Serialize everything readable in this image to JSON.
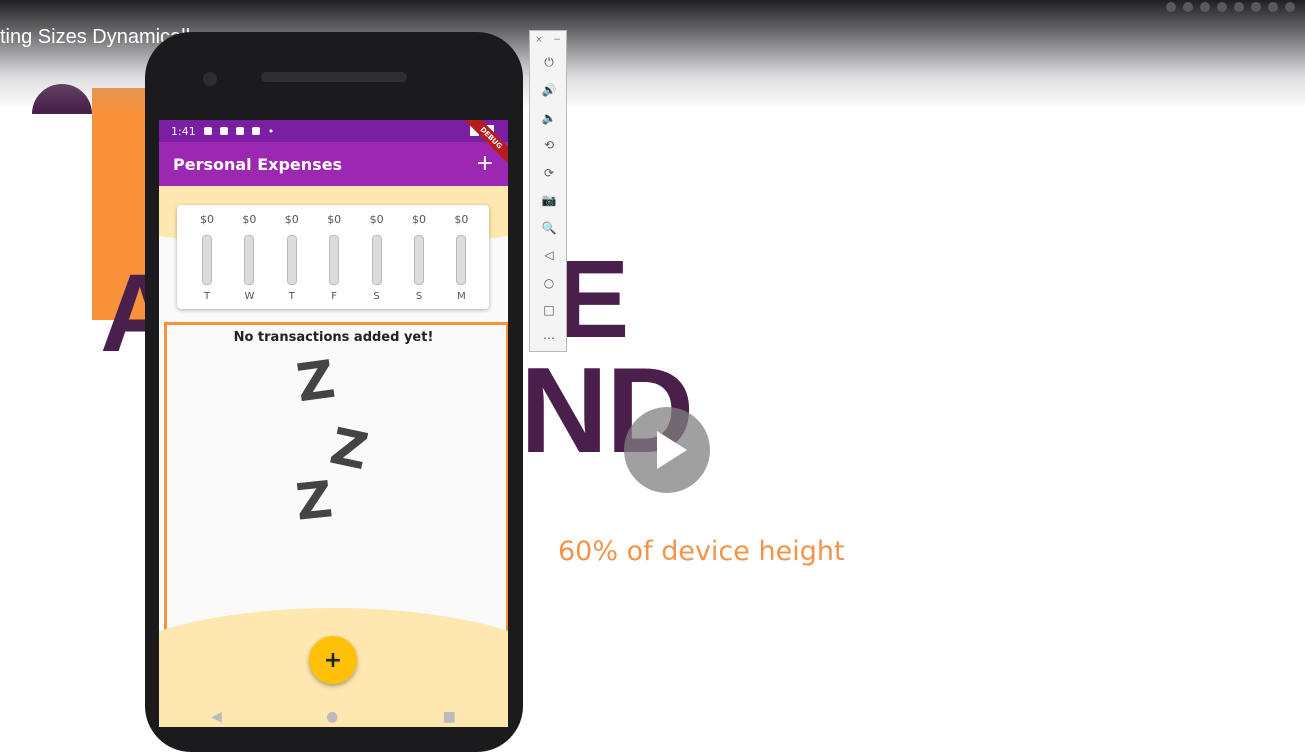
{
  "video": {
    "title": "ting Sizes Dynamically"
  },
  "slide": {
    "letters_a": "A",
    "letters_e": "E",
    "letters_nd": "ND",
    "caption": "60% of device height"
  },
  "emulator_toolbar": {
    "close": "×",
    "minimize": "−",
    "buttons": [
      {
        "name": "power-icon",
        "glyph": "⏻"
      },
      {
        "name": "volume-up-icon",
        "glyph": "🔊"
      },
      {
        "name": "volume-down-icon",
        "glyph": "🔈"
      },
      {
        "name": "rotate-left-icon",
        "glyph": "⟲"
      },
      {
        "name": "rotate-right-icon",
        "glyph": "⟳"
      },
      {
        "name": "camera-icon",
        "glyph": "📷"
      },
      {
        "name": "zoom-icon",
        "glyph": "🔍"
      },
      {
        "name": "back-icon",
        "glyph": "◁"
      },
      {
        "name": "home-icon",
        "glyph": "○"
      },
      {
        "name": "overview-icon",
        "glyph": "□"
      },
      {
        "name": "more-icon",
        "glyph": "⋯"
      }
    ]
  },
  "phone": {
    "status_time": "1:41",
    "debug_label": "DEBUG",
    "app_bar": {
      "title": "Personal Expenses",
      "add_glyph": "+"
    },
    "chart": {
      "bars": [
        {
          "amount": "$0",
          "day": "T",
          "fill": 0
        },
        {
          "amount": "$0",
          "day": "W",
          "fill": 0
        },
        {
          "amount": "$0",
          "day": "T",
          "fill": 0
        },
        {
          "amount": "$0",
          "day": "F",
          "fill": 0
        },
        {
          "amount": "$0",
          "day": "S",
          "fill": 0
        },
        {
          "amount": "$0",
          "day": "S",
          "fill": 0
        },
        {
          "amount": "$0",
          "day": "M",
          "fill": 0
        }
      ]
    },
    "empty_message": "No transactions added yet!",
    "zzz": [
      "Z",
      "Z",
      "Z"
    ],
    "fab_glyph": "+",
    "nav": {
      "back": "◀",
      "home": "●",
      "recents": "■"
    }
  },
  "colors": {
    "app_bar": "#9c27b0",
    "status_bar": "#7b1fa2",
    "accent": "#ffc107",
    "highlight_frame": "#f7923a",
    "slide_purple": "#4a1f4c"
  }
}
